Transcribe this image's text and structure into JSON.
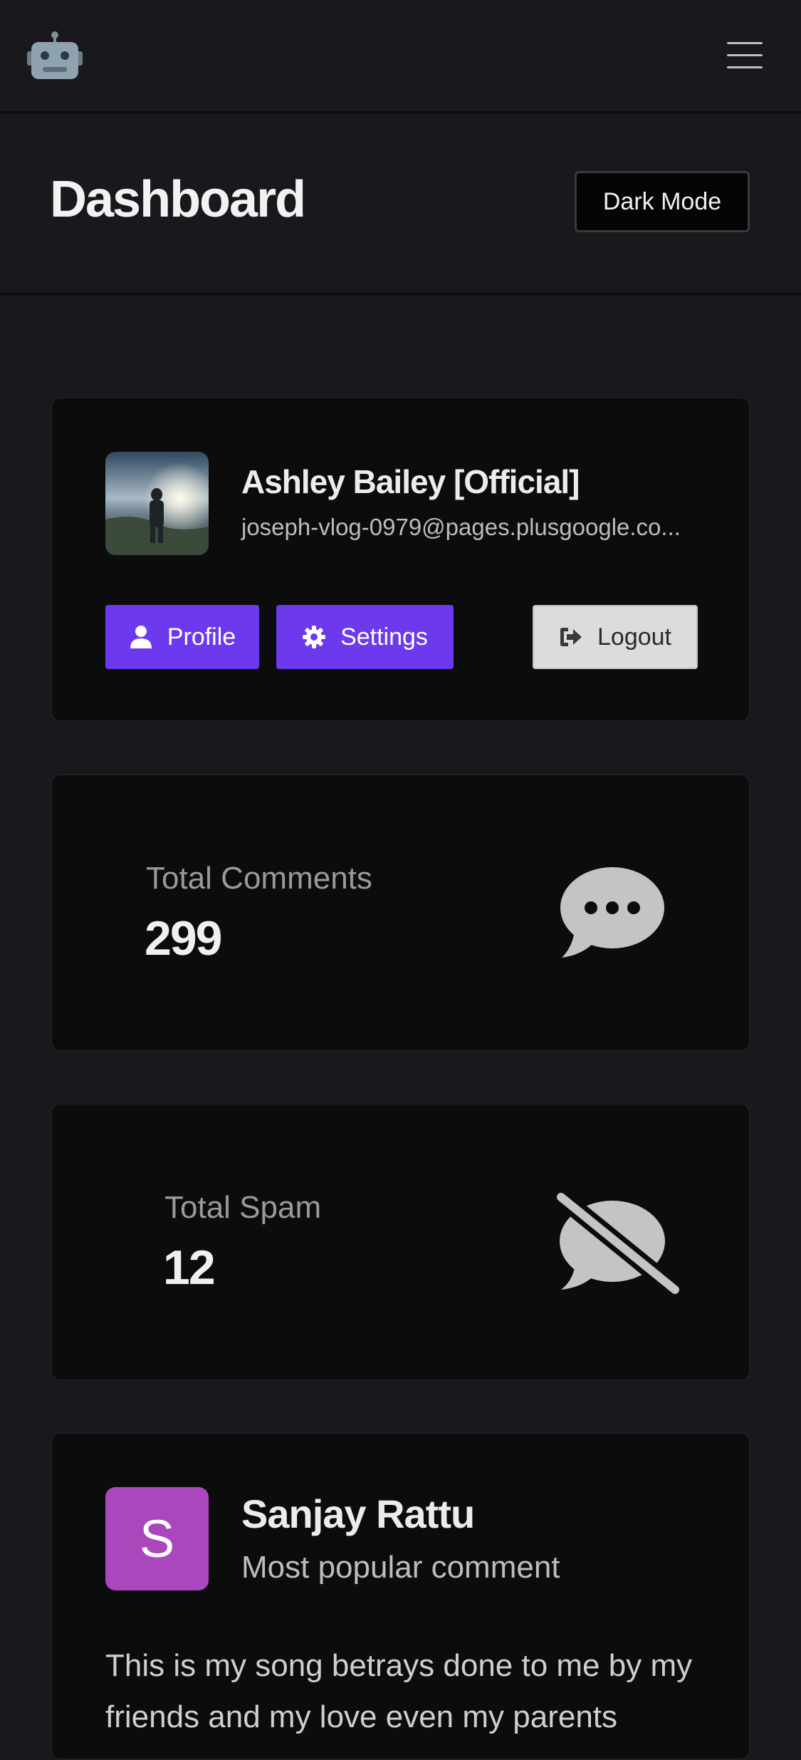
{
  "topbar": {
    "logo_icon": "robot-icon",
    "menu_icon": "hamburger-menu-icon"
  },
  "header": {
    "title": "Dashboard",
    "dark_mode_label": "Dark Mode"
  },
  "profile": {
    "name": "Ashley Bailey [Official]",
    "email": "joseph-vlog-0979@pages.plusgoogle.co...",
    "buttons": {
      "profile": "Profile",
      "settings": "Settings",
      "logout": "Logout"
    },
    "accent_color": "#6c3aec"
  },
  "stats": {
    "comments": {
      "label": "Total Comments",
      "value": "299",
      "icon": "comment-dots-icon"
    },
    "spam": {
      "label": "Total Spam",
      "value": "12",
      "icon": "comment-slash-icon"
    }
  },
  "popular_comment": {
    "avatar_letter": "S",
    "avatar_color": "#ab47bc",
    "name": "Sanjay Rattu",
    "subtitle": "Most popular comment",
    "text": "This is my song betrays done to me by my friends and my love even my parents"
  }
}
